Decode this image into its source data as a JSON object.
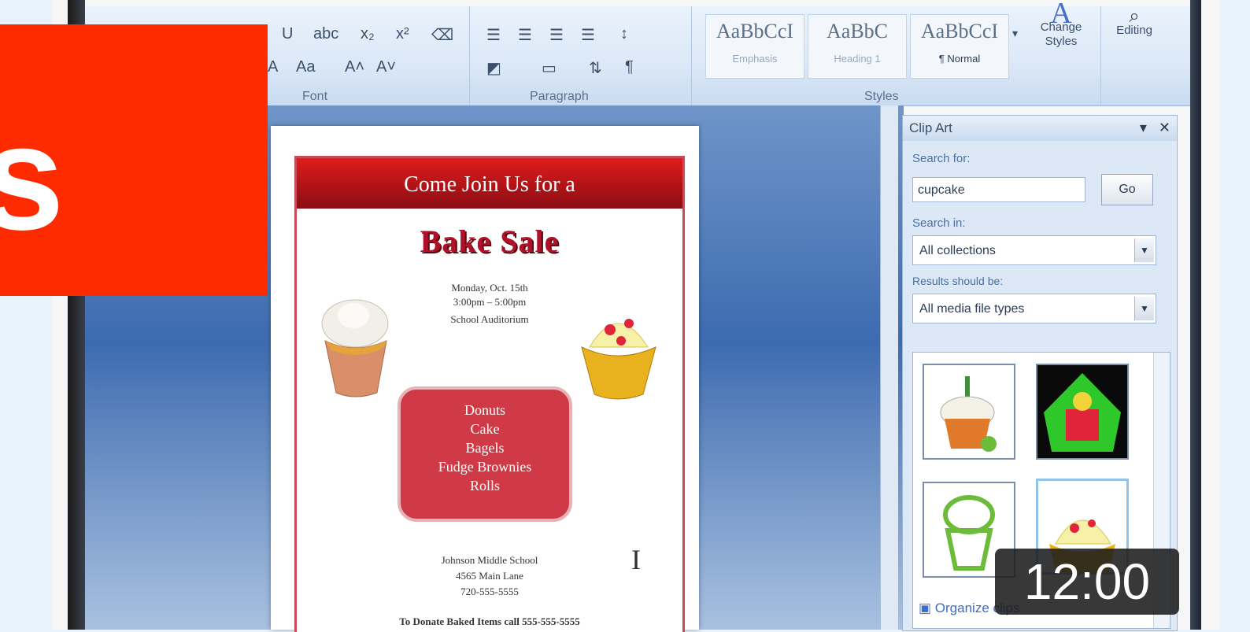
{
  "overlay": {
    "red_letter": "s",
    "duration": "12:00"
  },
  "ribbon": {
    "groups": {
      "font": "Font",
      "paragraph": "Paragraph",
      "styles": "Styles"
    },
    "styles_gallery": [
      {
        "sample": "AaBbCcI",
        "label": "Emphasis"
      },
      {
        "sample": "AaBbC",
        "label": "Heading 1"
      },
      {
        "sample": "AaBbCcI",
        "label": "¶ Normal"
      }
    ],
    "change_styles_label": "Change Styles",
    "editing_label": "Editing"
  },
  "flyer": {
    "header": "Come Join Us for a",
    "title": "Bake Sale",
    "event_info": [
      "Monday, Oct. 15th",
      "3:00pm – 5:00pm",
      "School Auditorium"
    ],
    "menu_items": [
      "Donuts",
      "Cake",
      "Bagels",
      "Fudge Brownies",
      "Rolls"
    ],
    "address": [
      "Johnson Middle School",
      "4565 Main Lane",
      "720-555-5555"
    ],
    "footer": "To Donate Baked Items call 555-555-5555"
  },
  "clip_art_panel": {
    "title": "Clip Art",
    "search_for_label": "Search for:",
    "search_value": "cupcake",
    "go_label": "Go",
    "search_in_label": "Search in:",
    "search_in_value": "All collections",
    "results_label": "Results should be:",
    "results_value": "All media file types",
    "organize_label": "Organize clips"
  },
  "colors": {
    "overlay_red": "#ff2b00",
    "flyer_red": "#b0102a",
    "ribbon_blue": "#dbe8f7"
  }
}
